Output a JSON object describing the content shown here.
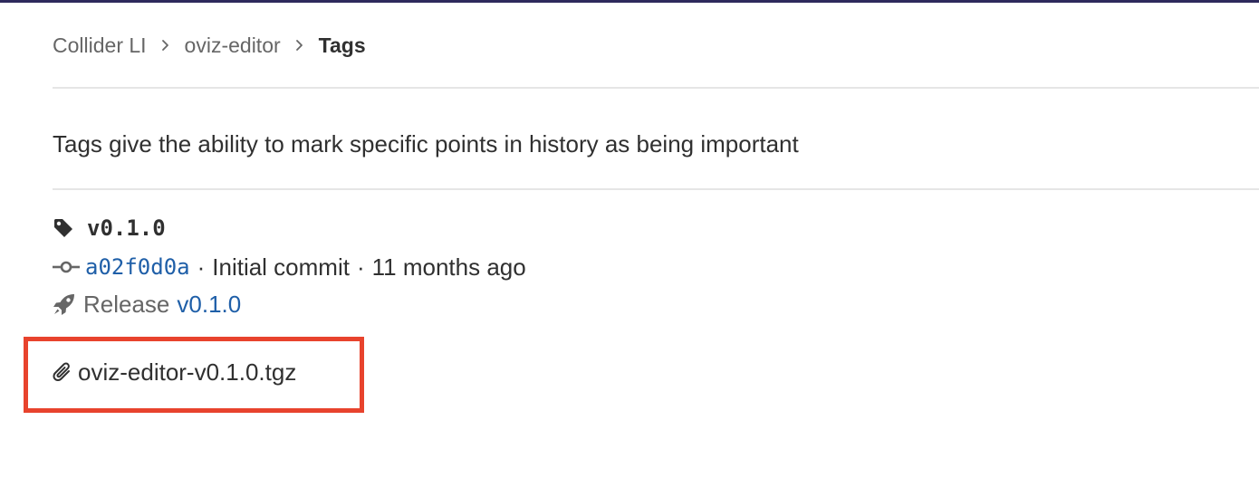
{
  "breadcrumb": {
    "items": [
      {
        "label": "Collider LI"
      },
      {
        "label": "oviz-editor"
      },
      {
        "label": "Tags"
      }
    ]
  },
  "description": "Tags give the ability to mark specific points in history as being important",
  "tag": {
    "name": "v0.1.0",
    "icon": "tag-icon",
    "commit": {
      "icon": "commit-icon",
      "sha": "a02f0d0a",
      "separator": "·",
      "message": "Initial commit",
      "time_ago": "11 months ago"
    },
    "release": {
      "icon": "rocket-icon",
      "label": "Release",
      "link": "v0.1.0"
    },
    "asset": {
      "icon": "paperclip-icon",
      "filename": "oviz-editor-v0.1.0.tgz"
    }
  },
  "colors": {
    "link": "#1f5fa8",
    "highlight": "#e8432d",
    "muted_text": "#666666"
  }
}
